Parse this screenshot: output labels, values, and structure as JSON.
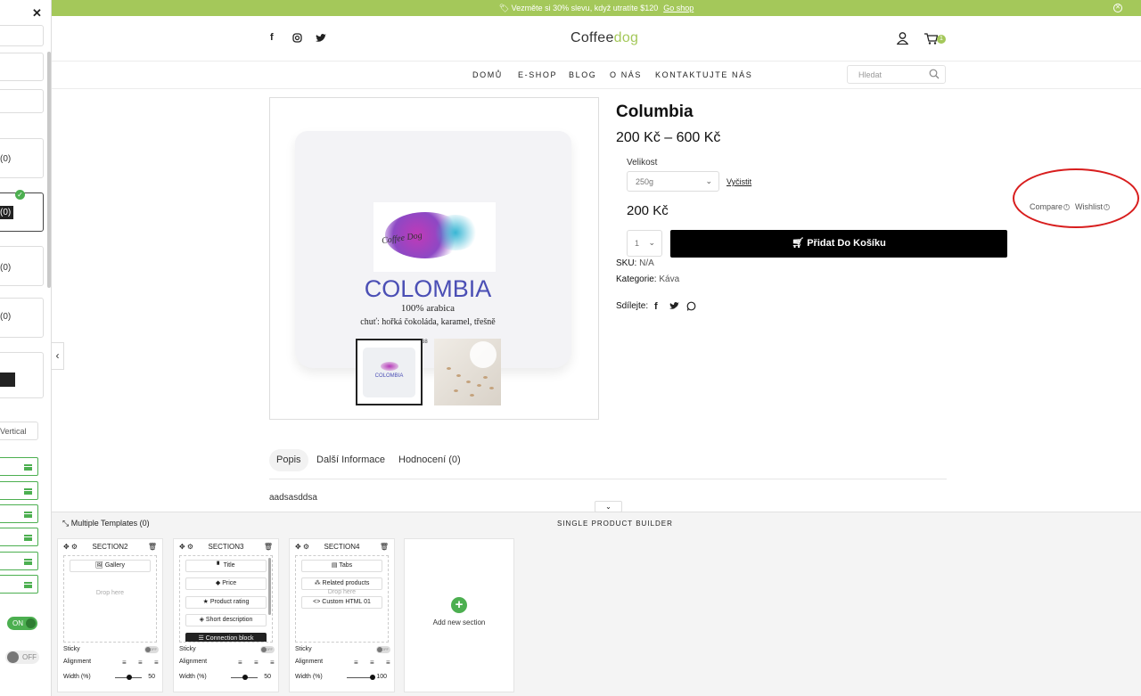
{
  "announcement": {
    "text": "🏷 Vezměte si 30% slevu, když utratíte $120",
    "link": "Go shop"
  },
  "header": {
    "logo_main": "Coffee",
    "logo_accent": "dog",
    "cart_count": "1",
    "nav": [
      "DOMŮ",
      "E-SHOP",
      "BLOG",
      "O NÁS",
      "KONTAKTUJTE NÁS"
    ],
    "search_placeholder": "Hledat"
  },
  "product": {
    "title": "Columbia",
    "price_range": "200 Kč – 600 Kč",
    "variant_label": "Velikost",
    "variant_value": "250g",
    "clear_label": "Vyčistit",
    "current_price": "200 Kč",
    "qty": "1",
    "add_to_cart": "Přidat Do Košíku",
    "sku_label": "SKU:",
    "sku_value": "N/A",
    "category_label": "Kategorie:",
    "category_value": "Káva",
    "share_label": "Sdílejte:",
    "compare": "Compare",
    "wishlist": "Wishlist",
    "image": {
      "title": "COLOMBIA",
      "subtitle": "100% arabica",
      "taste": "chuť:  hořká čokoláda, karamel, třešně",
      "label_script": "Coffee Dog",
      "thumb_title": "COLOMBIA"
    }
  },
  "tabs": [
    {
      "label": "Popis"
    },
    {
      "label": "Další Informace"
    },
    {
      "label": "Hodnocení (0)"
    }
  ],
  "description": "aadsasddsa",
  "leftpanel": {
    "counts": [
      "(0)",
      "(0)",
      "(0)",
      "(0)"
    ],
    "dark_count": "(0)",
    "vertical_label": "Vertical",
    "last_green_label": "o",
    "toggle_on": "ON",
    "toggle_off": "OFF"
  },
  "builder": {
    "multi_templates": "Multiple Templates (0)",
    "title": "SINGLE PRODUCT BUILDER",
    "drop_here": "Drop here",
    "sticky_label": "Sticky",
    "sticky_state": "OFF",
    "alignment_label": "Alignment",
    "width_label": "Width (%)",
    "sections": [
      {
        "name": "SECTION2",
        "widgets": [
          "🖼 Gallery"
        ],
        "width": "50"
      },
      {
        "name": "SECTION3",
        "widgets": [
          "▘ Title",
          "◆ Price",
          "★ Product rating",
          "◈ Short description",
          "☰ Connection block"
        ],
        "width": "50"
      },
      {
        "name": "SECTION4",
        "widgets": [
          "▤ Tabs",
          "⁂ Related products",
          "<> Custom HTML 01"
        ],
        "width": "100"
      }
    ],
    "add_new": "Add new section"
  },
  "colors": {
    "accent": "#a4c85a",
    "builder_green": "#4caf50",
    "annotation": "#d81e1e"
  }
}
